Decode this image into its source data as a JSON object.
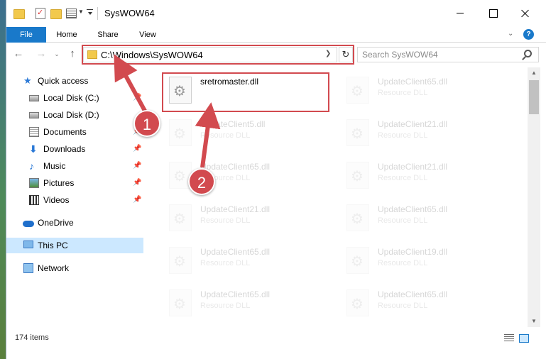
{
  "window": {
    "title": "SysWOW64",
    "controls": {
      "minimize": "",
      "maximize": "",
      "close": ""
    }
  },
  "ribbon": {
    "tabs": [
      "File",
      "Home",
      "Share",
      "View"
    ],
    "help": "?"
  },
  "address_bar": {
    "path": "C:\\Windows\\SysWOW64",
    "refresh": "↻"
  },
  "search": {
    "placeholder": "Search SysWOW64"
  },
  "navigation": {
    "back": "←",
    "forward": "→",
    "recent": "⌄",
    "up": "↑"
  },
  "sidebar": {
    "items": [
      {
        "label": "Quick access",
        "icon": "star-icon",
        "pinned": false
      },
      {
        "label": "Local Disk (C:)",
        "icon": "drive-icon",
        "pinned": true
      },
      {
        "label": "Local Disk (D:)",
        "icon": "drive-icon",
        "pinned": false
      },
      {
        "label": "Documents",
        "icon": "documents-icon",
        "pinned": true
      },
      {
        "label": "Downloads",
        "icon": "download-icon",
        "pinned": true
      },
      {
        "label": "Music",
        "icon": "music-icon",
        "pinned": true
      },
      {
        "label": "Pictures",
        "icon": "pictures-icon",
        "pinned": true
      },
      {
        "label": "Videos",
        "icon": "videos-icon",
        "pinned": true
      },
      {
        "label": "OneDrive",
        "icon": "cloud-icon",
        "pinned": false
      },
      {
        "label": "This PC",
        "icon": "computer-icon",
        "pinned": false,
        "selected": true
      },
      {
        "label": "Network",
        "icon": "network-icon",
        "pinned": false
      }
    ],
    "pin_glyph": "📌"
  },
  "files": [
    {
      "name": "sretromaster.dll",
      "type": "",
      "highlighted": true
    },
    {
      "name": "UpdateClient65.dll",
      "type": "Resource DLL"
    },
    {
      "name": "UpdateClient5.dll",
      "type": "Resource DLL"
    },
    {
      "name": "UpdateClient21.dll",
      "type": "Resource DLL"
    },
    {
      "name": "UpdateClient65.dll",
      "type": "Resource DLL"
    },
    {
      "name": "UpdateClient21.dll",
      "type": "Resource DLL"
    },
    {
      "name": "UpdateClient21.dll",
      "type": "Resource DLL"
    },
    {
      "name": "UpdateClient65.dll",
      "type": "Resource DLL"
    },
    {
      "name": "UpdateClient65.dll",
      "type": "Resource DLL"
    },
    {
      "name": "UpdateClient19.dll",
      "type": "Resource DLL"
    },
    {
      "name": "UpdateClient65.dll",
      "type": "Resource DLL"
    },
    {
      "name": "UpdateClient65.dll",
      "type": "Resource DLL"
    }
  ],
  "annotations": {
    "marker_1": "1",
    "marker_2": "2",
    "color": "#d24a4f"
  },
  "status": {
    "item_count": "174 items"
  },
  "colors": {
    "accent": "#1979ca",
    "selection": "#cce8ff",
    "highlight": "#d24a4f"
  }
}
